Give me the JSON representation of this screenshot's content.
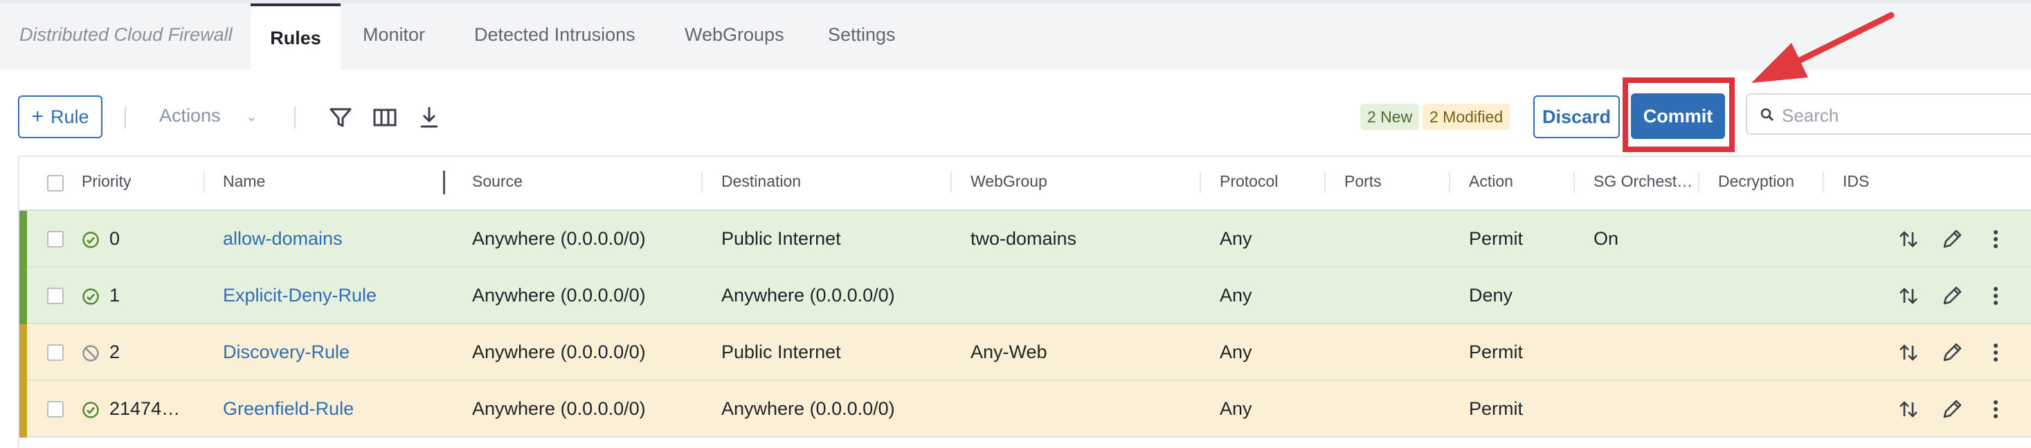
{
  "app_title": "Distributed Cloud Firewall",
  "tabs": [
    {
      "label": "Rules",
      "active": true
    },
    {
      "label": "Monitor"
    },
    {
      "label": "Detected Intrusions"
    },
    {
      "label": "WebGroups"
    },
    {
      "label": "Settings"
    }
  ],
  "toolbar": {
    "add_rule_label": "Rule",
    "add_rule_icon": "plus-icon",
    "actions_label": "Actions",
    "actions_icon": "chevron-down-icon",
    "icons": [
      "filter-icon",
      "columns-icon",
      "download-icon"
    ],
    "new_badge": "2 New",
    "modified_badge": "2 Modified",
    "discard_label": "Discard",
    "commit_label": "Commit",
    "search_placeholder": "Search",
    "search_icon": "search-icon"
  },
  "annotation": {
    "highlight_color": "#e0303a",
    "arrow_color": "#e0393f"
  },
  "table": {
    "columns": [
      "Priority",
      "Name",
      "Source",
      "Destination",
      "WebGroup",
      "Protocol",
      "Ports",
      "Action",
      "SG Orchest…",
      "Decryption",
      "IDS"
    ],
    "rows": [
      {
        "status": "enabled",
        "status_icon": "check-circle-icon",
        "priority": "0",
        "name": "allow-domains",
        "source": "Anywhere (0.0.0.0/0)",
        "destination": "Public Internet",
        "webgroup": "two-domains",
        "protocol": "Any",
        "ports": "",
        "action": "Permit",
        "sg_orchestration": "On",
        "decryption": "",
        "ids": "",
        "state": "new",
        "color": "#6a9e3f"
      },
      {
        "status": "enabled",
        "status_icon": "check-circle-icon",
        "priority": "1",
        "name": "Explicit-Deny-Rule",
        "source": "Anywhere (0.0.0.0/0)",
        "destination": "Anywhere (0.0.0.0/0)",
        "webgroup": "",
        "protocol": "Any",
        "ports": "",
        "action": "Deny",
        "sg_orchestration": "",
        "decryption": "",
        "ids": "",
        "state": "new",
        "color": "#6a9e3f"
      },
      {
        "status": "disabled",
        "status_icon": "ban-circle-icon",
        "priority": "2",
        "name": "Discovery-Rule",
        "source": "Anywhere (0.0.0.0/0)",
        "destination": "Public Internet",
        "webgroup": "Any-Web",
        "protocol": "Any",
        "ports": "",
        "action": "Permit",
        "sg_orchestration": "",
        "decryption": "",
        "ids": "",
        "state": "modified",
        "color": "#c9a32e"
      },
      {
        "status": "enabled",
        "status_icon": "check-circle-icon",
        "priority": "21474…",
        "name": "Greenfield-Rule",
        "source": "Anywhere (0.0.0.0/0)",
        "destination": "Anywhere (0.0.0.0/0)",
        "webgroup": "",
        "protocol": "Any",
        "ports": "",
        "action": "Permit",
        "sg_orchestration": "",
        "decryption": "",
        "ids": "",
        "state": "modified",
        "color": "#c9a32e"
      }
    ],
    "row_actions": [
      "reorder-icon",
      "edit-pencil-icon",
      "more-vertical-icon"
    ]
  },
  "colors": {
    "accent": "#2f6db5",
    "new_row_bg": "#e5f1dd",
    "modified_row_bg": "#fbf0d5"
  }
}
